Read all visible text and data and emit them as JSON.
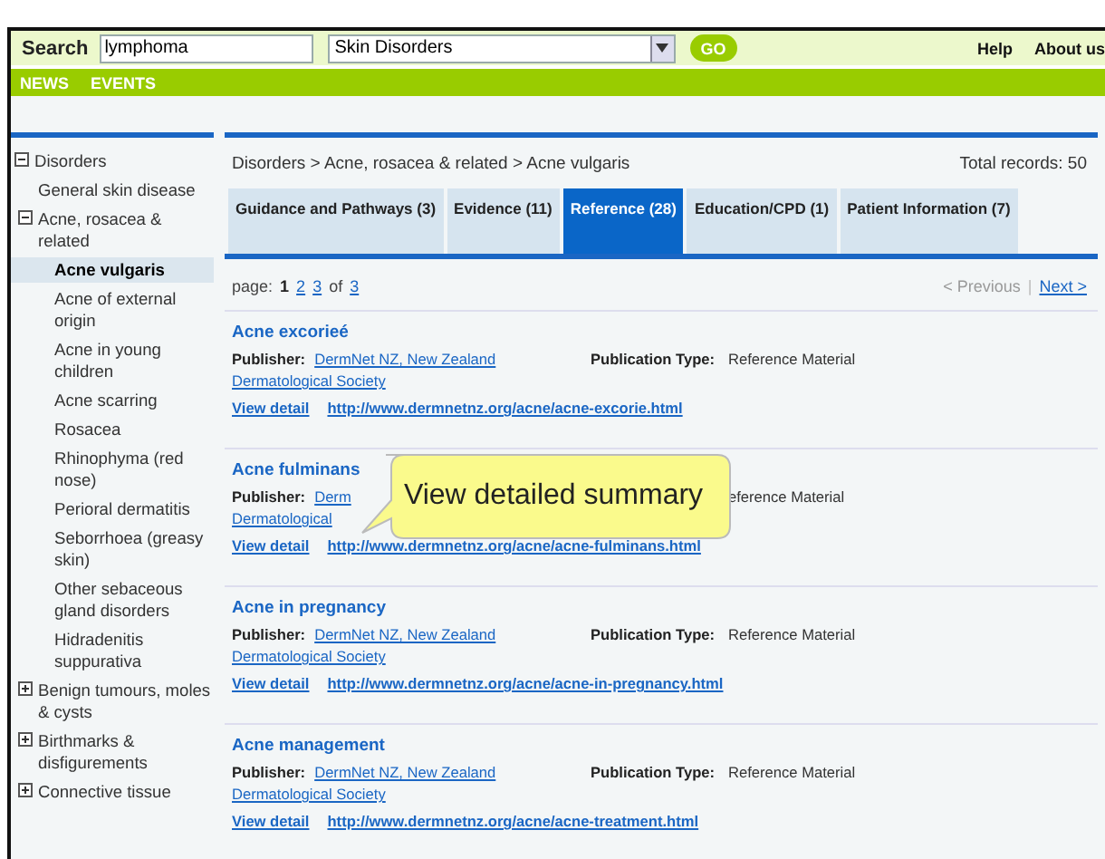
{
  "header": {
    "search_label": "Search",
    "search_value": "lymphoma",
    "category": "Skin Disorders",
    "go": "GO",
    "links": [
      "Help",
      "About us"
    ]
  },
  "nav": [
    "NEWS",
    "EVENTS"
  ],
  "sidebar": {
    "tree": [
      {
        "label": "Disorders",
        "expanded": true,
        "selected": false,
        "children": [
          {
            "label": "General skin disease",
            "selected": false
          },
          {
            "label": "Acne, rosacea & related",
            "expanded": true,
            "selected": false,
            "children": [
              {
                "label": "Acne vulgaris",
                "selected": true
              },
              {
                "label": "Acne of external origin",
                "selected": false
              },
              {
                "label": "Acne in young children",
                "selected": false
              },
              {
                "label": "Acne scarring",
                "selected": false
              },
              {
                "label": "Rosacea",
                "selected": false
              },
              {
                "label": "Rhinophyma (red nose)",
                "selected": false
              },
              {
                "label": "Perioral dermatitis",
                "selected": false
              },
              {
                "label": "Seborrhoea (greasy skin)",
                "selected": false
              },
              {
                "label": "Other sebaceous gland disorders",
                "selected": false
              },
              {
                "label": "Hidradenitis suppurativa",
                "selected": false
              }
            ]
          },
          {
            "label": "Benign tumours, moles & cysts",
            "expanded": false,
            "selected": false
          },
          {
            "label": "Birthmarks & disfigurements",
            "expanded": false,
            "selected": false
          },
          {
            "label": "Connective tissue",
            "expanded": false,
            "selected": false
          }
        ]
      }
    ]
  },
  "breadcrumb": "Disorders > Acne, rosacea & related > Acne vulgaris",
  "total": "Total records: 50",
  "tabs": [
    {
      "label": "Guidance and Pathways (3)",
      "selected": false
    },
    {
      "label": "Evidence (11)",
      "selected": false
    },
    {
      "label": "Reference (28)",
      "selected": true
    },
    {
      "label": "Education/CPD (1)",
      "selected": false
    },
    {
      "label": "Patient Information (7)",
      "selected": false
    }
  ],
  "pager": {
    "label": "page:",
    "pages": [
      {
        "label": "1",
        "selected": true
      },
      {
        "label": "2",
        "selected": false
      },
      {
        "label": "3",
        "selected": false
      }
    ],
    "of": "of",
    "last": "3",
    "previous": "< Previous",
    "separator": "|",
    "next": "Next >"
  },
  "records": [
    {
      "title": "Acne excorieé",
      "publisher_label": "Publisher:",
      "publisher": [
        "DermNet NZ, New Zealand",
        "Dermatological Society"
      ],
      "type_label": "Publication Type:",
      "type": "Reference Material",
      "view": "View detail",
      "url": "http://www.dermnetnz.org/acne/acne-excorie.html"
    },
    {
      "title": "Acne fulminans",
      "publisher_label": "Publisher:",
      "publisher": [
        "Derm",
        "Dermatological"
      ],
      "type": "eference Material",
      "view": "View detail",
      "url": "http://www.dermnetnz.org/acne/acne-fulminans.html",
      "tooltip": "View detailed summary"
    },
    {
      "title": "Acne in pregnancy",
      "publisher_label": "Publisher:",
      "publisher": [
        "DermNet NZ, New Zealand",
        "Dermatological Society"
      ],
      "type_label": "Publication Type:",
      "type": "Reference Material",
      "view": "View detail",
      "url": "http://www.dermnetnz.org/acne/acne-in-pregnancy.html"
    },
    {
      "title": "Acne management",
      "publisher_label": "Publisher:",
      "publisher": [
        "DermNet NZ, New Zealand",
        "Dermatological Society"
      ],
      "type_label": "Publication Type:",
      "type": "Reference Material",
      "view": "View detail",
      "url": "http://www.dermnetnz.org/acne/acne-treatment.html"
    }
  ]
}
